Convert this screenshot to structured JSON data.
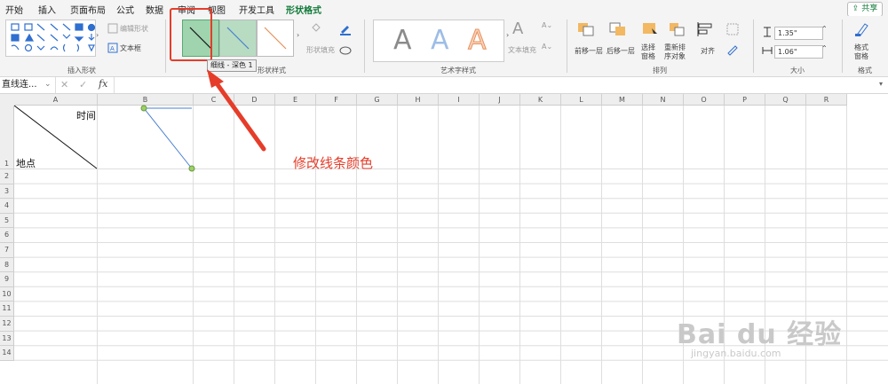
{
  "tabs": [
    "开始",
    "插入",
    "页面布局",
    "公式",
    "数据",
    "审阅",
    "视图",
    "开发工具",
    "形状格式"
  ],
  "active_tab": "形状格式",
  "share_label": "共享",
  "ribbon": {
    "insert_shapes": {
      "edit_shape": "编辑形状",
      "text_box": "文本框",
      "label": "插入形状"
    },
    "shape_styles": {
      "fill_label": "形状填充",
      "label": "形状样式"
    },
    "wordart": {
      "letter": "A",
      "text_fill": "文本填充",
      "label": "艺术字样式"
    },
    "arrange": {
      "bring_forward": "前移一层",
      "send_backward": "后移一层",
      "selection_pane_1": "选择",
      "selection_pane_2": "窗格",
      "reorder_1": "重新排",
      "reorder_2": "序对象",
      "align": "对齐",
      "label": "排列"
    },
    "size": {
      "height": "1.35\"",
      "width": "1.06\"",
      "label": "大小"
    },
    "format": {
      "pane_1": "格式",
      "pane_2": "窗格",
      "label": "格式"
    }
  },
  "tooltip": "细线 - 深色 1",
  "formula_bar": {
    "name_box": "直线连...",
    "fx": "fx"
  },
  "columns": [
    "A",
    "B",
    "C",
    "D",
    "E",
    "F",
    "G",
    "H",
    "I",
    "J",
    "K",
    "L",
    "M",
    "N",
    "O",
    "P",
    "Q",
    "R"
  ],
  "rows": [
    "1",
    "2",
    "3",
    "4",
    "5",
    "6",
    "7",
    "8",
    "9",
    "10",
    "11",
    "12",
    "13",
    "14"
  ],
  "cells": {
    "a1_top": "时间",
    "a1_bottom": "地点"
  },
  "annotation": "修改线条颜色",
  "watermark": {
    "main": "Bai du 经验",
    "sub": "jingyan.baidu.com"
  },
  "colors": {
    "accent": "#127a3a",
    "annotation": "#e53d2a",
    "selected_style": "#9fd4ae"
  }
}
